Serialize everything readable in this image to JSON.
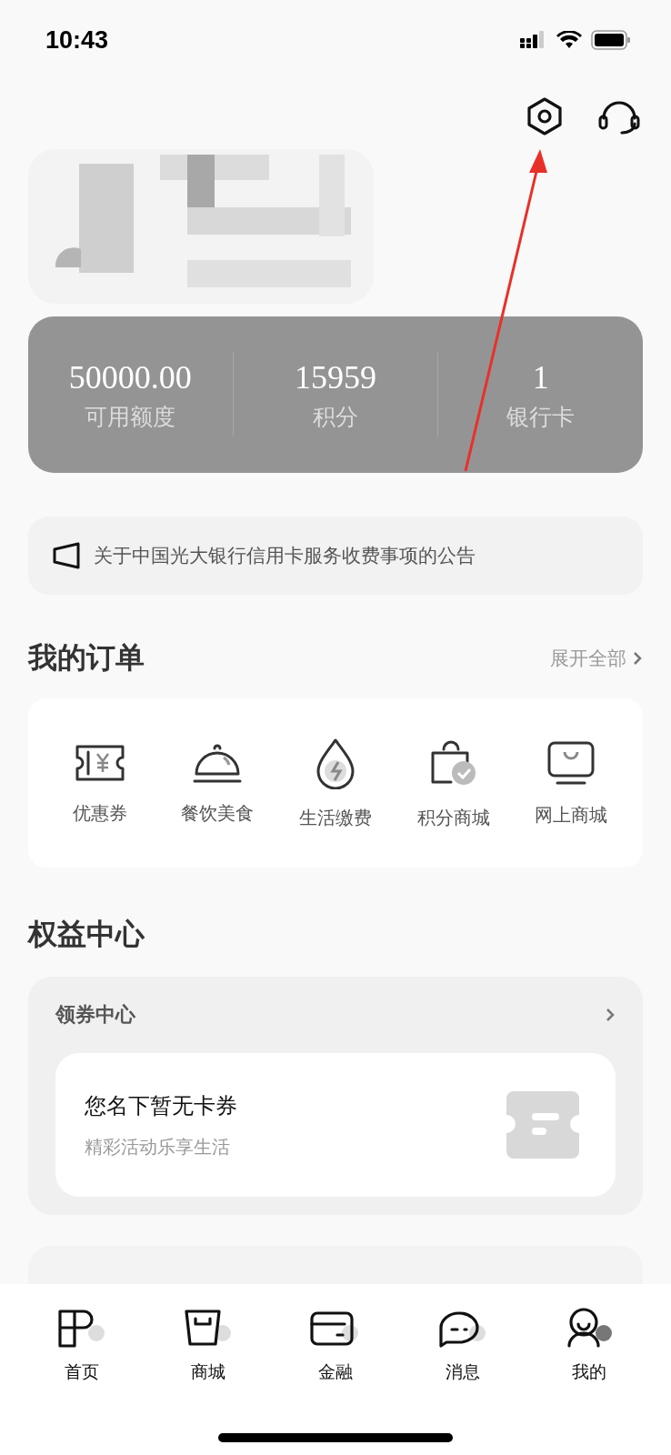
{
  "status_bar": {
    "time": "10:43"
  },
  "stats": [
    {
      "value": "50000.00",
      "label": "可用额度"
    },
    {
      "value": "15959",
      "label": "积分"
    },
    {
      "value": "1",
      "label": "银行卡"
    }
  ],
  "notice": {
    "text": "关于中国光大银行信用卡服务收费事项的公告"
  },
  "orders": {
    "title": "我的订单",
    "more": "展开全部",
    "items": [
      {
        "kind": "coupon",
        "label": "优惠券"
      },
      {
        "kind": "dining",
        "label": "餐饮美食"
      },
      {
        "kind": "utility",
        "label": "生活缴费"
      },
      {
        "kind": "points",
        "label": "积分商城"
      },
      {
        "kind": "shop",
        "label": "网上商城"
      }
    ]
  },
  "benefits": {
    "title": "权益中心",
    "coupon_center": {
      "title": "领券中心",
      "empty_title": "您名下暂无卡券",
      "empty_subtitle": "精彩活动乐享生活"
    }
  },
  "tab_bar": [
    {
      "kind": "home",
      "label": "首页",
      "selected": false
    },
    {
      "kind": "mall",
      "label": "商城",
      "selected": false
    },
    {
      "kind": "finance",
      "label": "金融",
      "selected": false
    },
    {
      "kind": "message",
      "label": "消息",
      "selected": false
    },
    {
      "kind": "me",
      "label": "我的",
      "selected": true
    }
  ]
}
